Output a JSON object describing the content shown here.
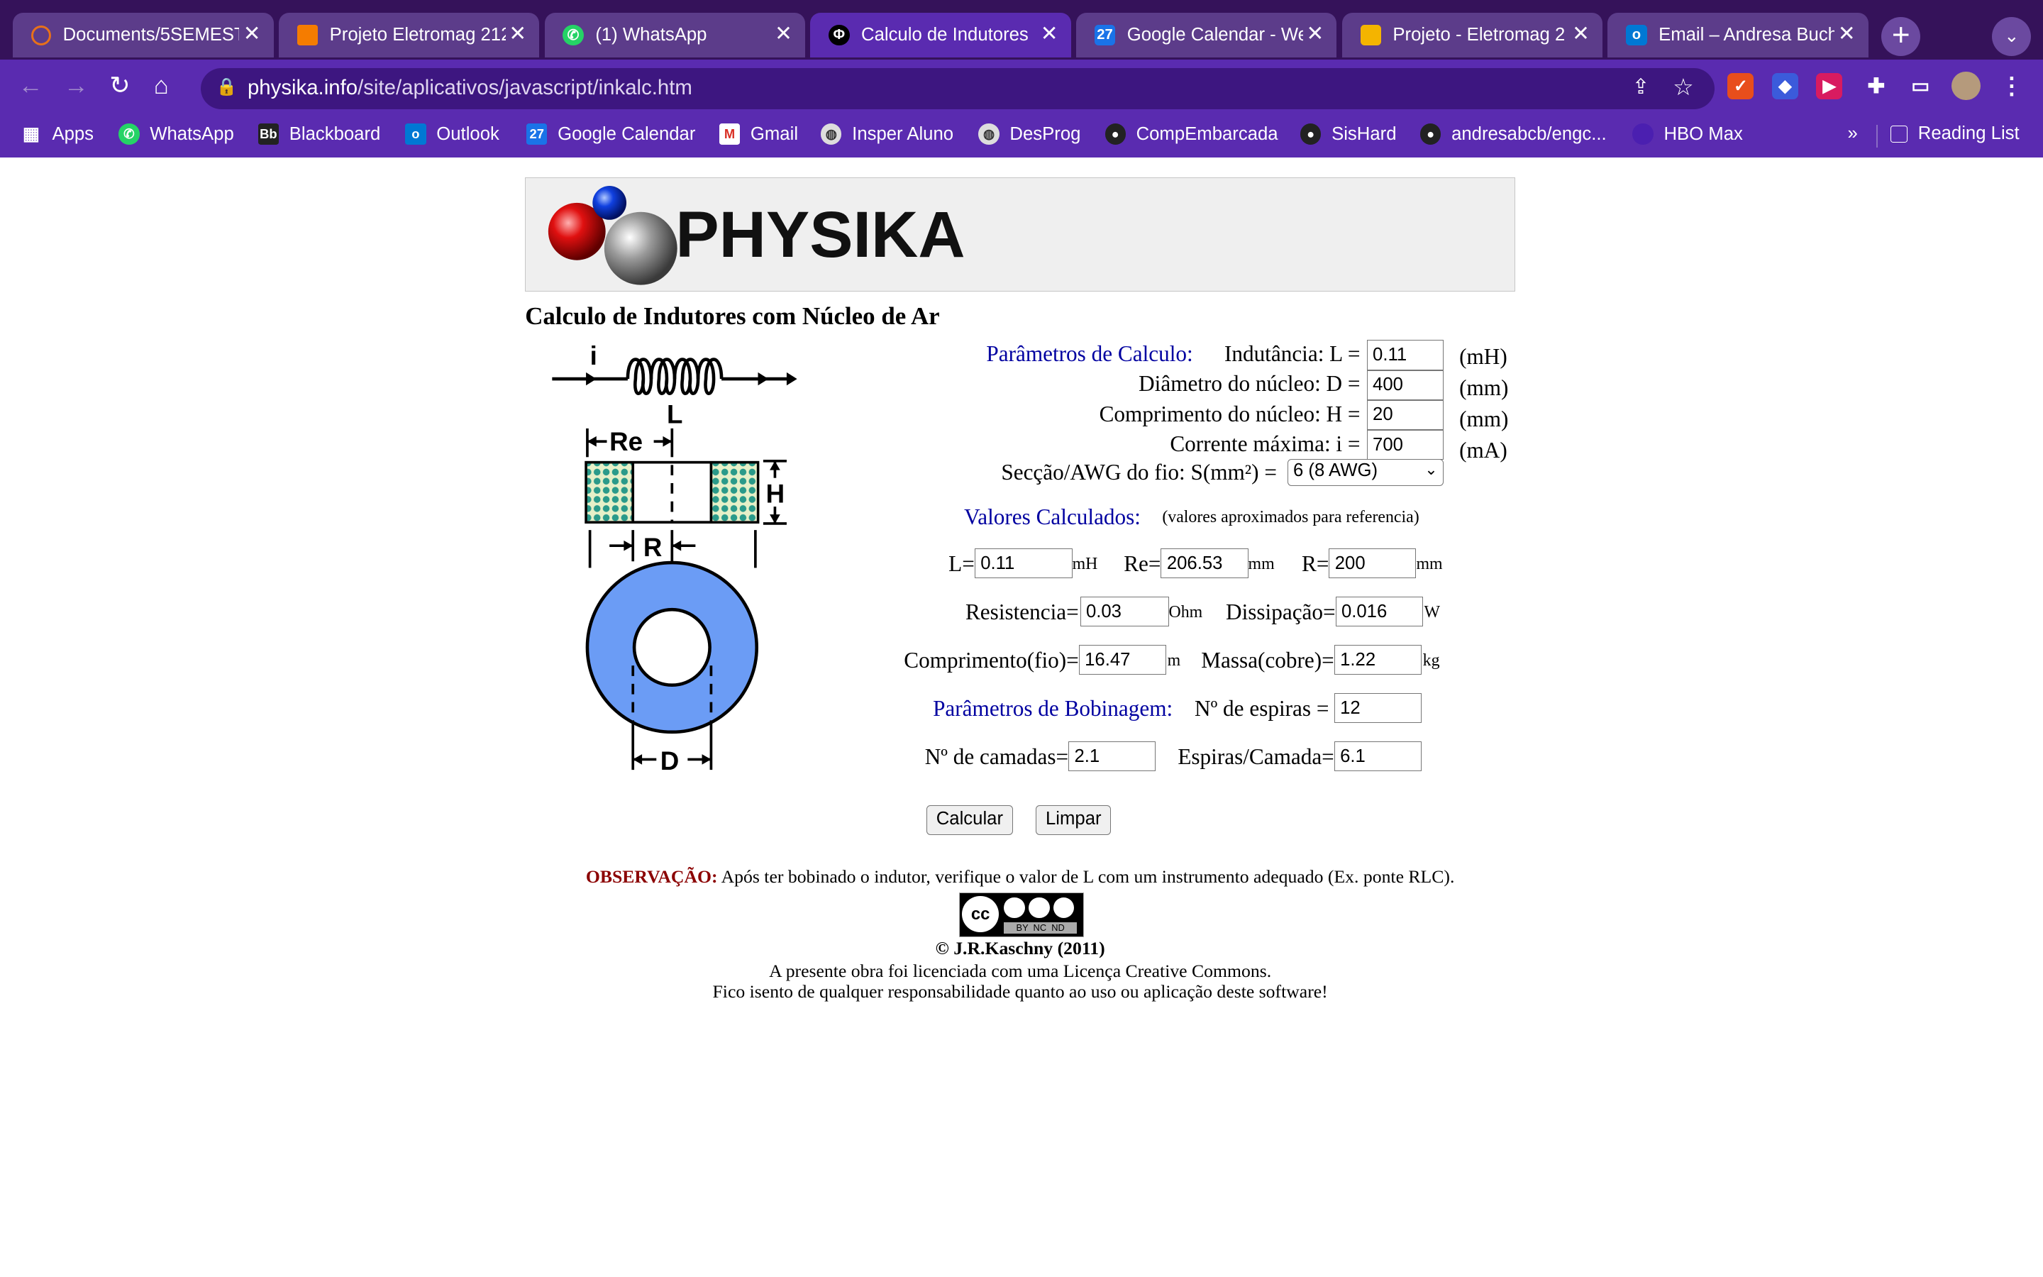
{
  "browser": {
    "tabs": [
      {
        "title": "Documents/5SEMEST",
        "color": "#e8711a"
      },
      {
        "title": "Projeto Eletromag 212",
        "color": "#f57c00"
      },
      {
        "title": "(1) WhatsApp",
        "color": "#25d366"
      },
      {
        "title": "Calculo de Indutores",
        "color": "#000000"
      },
      {
        "title": "Google Calendar - We",
        "color": "#1a73e8"
      },
      {
        "title": "Projeto - Eletromag 2",
        "color": "#f4b400"
      },
      {
        "title": "Email – Andresa Buch",
        "color": "#0078d4"
      }
    ],
    "url_domain": "physika.info",
    "url_path": "/site/aplicativos/javascript/inkalc.htm",
    "bookmarks": [
      "Apps",
      "WhatsApp",
      "Blackboard",
      "Outlook",
      "Google Calendar",
      "Gmail",
      "Insper Aluno",
      "DesProg",
      "CompEmbarcada",
      "SisHard",
      "andresabcb/engc...",
      "HBO Max"
    ],
    "reading_list": "Reading List"
  },
  "page": {
    "logo_text": "PHYSIKA",
    "title": "Calculo de Indutores com Núcleo de Ar",
    "params": {
      "heading": "Parâmetros de Calculo:",
      "inductance_label": "Indutância: L =",
      "inductance_value": "0.11",
      "inductance_unit": "(mH)",
      "diameter_label": "Diâmetro do núcleo: D =",
      "diameter_value": "400",
      "diameter_unit": "(mm)",
      "length_label": "Comprimento do núcleo: H =",
      "length_value": "20",
      "length_unit": "(mm)",
      "current_label": "Corrente máxima: i =",
      "current_value": "700",
      "current_unit": "(mA)",
      "wire_label": "Secção/AWG do fio: S(mm²) =",
      "wire_selected": "6 (8 AWG)"
    },
    "calculated": {
      "heading": "Valores Calculados:",
      "note": "(valores aproximados para referencia)",
      "L_label": "L=",
      "L_value": "0.11",
      "L_unit": "mH",
      "Re_label": "Re=",
      "Re_value": "206.53",
      "Re_unit": "mm",
      "R_label": "R=",
      "R_value": "200",
      "R_unit": "mm",
      "res_label": "Resistencia=",
      "res_value": "0.03",
      "res_unit": "Ohm",
      "diss_label": "Dissipação=",
      "diss_value": "0.016",
      "diss_unit": "W",
      "wire_len_label": "Comprimento(fio)=",
      "wire_len_value": "16.47",
      "wire_len_unit": "m",
      "mass_label": "Massa(cobre)=",
      "mass_value": "1.22",
      "mass_unit": "kg"
    },
    "winding": {
      "heading": "Parâmetros de Bobinagem:",
      "turns_label": "Nº de espiras =",
      "turns_value": "12",
      "layers_label": "Nº de camadas=",
      "layers_value": "2.1",
      "per_layer_label": "Espiras/Camada=",
      "per_layer_value": "6.1"
    },
    "buttons": {
      "calc": "Calcular",
      "clear": "Limpar"
    },
    "diagram_labels": {
      "i": "i",
      "L": "L",
      "Re": "Re",
      "H": "H",
      "R": "R",
      "D": "D"
    },
    "observation_label": "OBSERVAÇÃO:",
    "observation_text": "Após ter bobinado o indutor, verifique o valor de L com um instrumento adequado (Ex. ponte RLC).",
    "copyright": "© J.R.Kaschny (2011)",
    "license": "A presente obra foi licenciada com uma Licença Creative Commons.",
    "disclaimer": "Fico isento de qualquer responsabilidade quanto ao uso ou aplicação deste software!",
    "cc_badge": {
      "top": "cc",
      "bottom": "BY  NC  ND"
    }
  }
}
